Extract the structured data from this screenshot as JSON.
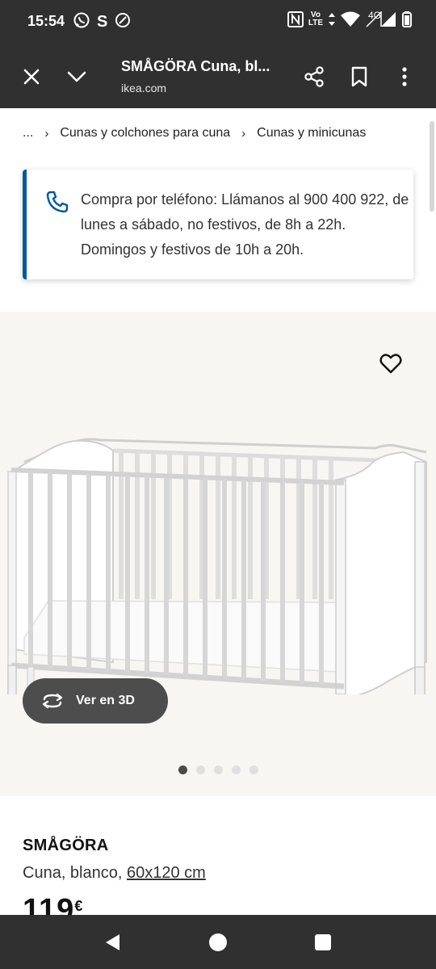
{
  "status": {
    "time": "15:54",
    "left_icons": [
      "whatsapp-icon",
      "s-app-icon",
      "leaf-app-icon"
    ],
    "right_icons": [
      "nfc-icon",
      "volte-icon",
      "data-arrows-icon",
      "wifi-icon",
      "signal-icon",
      "battery-icon"
    ],
    "volte_label_top": "Vo",
    "volte_label_bottom": "LTE",
    "network_label": "4G"
  },
  "toolbar": {
    "title": "SMÅGÖRA Cuna, bl...",
    "url": "ikea.com",
    "icons": [
      "close-icon",
      "chevron-down-icon",
      "share-icon",
      "bookmark-icon",
      "more-vert-icon"
    ]
  },
  "breadcrumb": {
    "ellipsis": "...",
    "items": [
      "Cunas y colchones para cuna",
      "Cunas y minicunas"
    ]
  },
  "info": {
    "icon": "phone-icon",
    "text": "Compra por teléfono: Llámanos al 900 400 922, de lunes a sábado, no festivos, de 8h a 22h. Domingos y festivos de 10h a 20h.",
    "accent_color": "#0058a3"
  },
  "gallery": {
    "favorite_icon": "heart-icon",
    "view_3d_label": "Ver en 3D",
    "view_3d_icon": "rotate-3d-icon",
    "slide_count": 5,
    "active_slide": 1
  },
  "product": {
    "name": "SMÅGÖRA",
    "desc_prefix": "Cuna, blanco, ",
    "size": "60x120 cm",
    "price": "119",
    "currency": "€"
  },
  "nav": {
    "icons": [
      "back-icon",
      "home-icon",
      "recents-icon"
    ]
  }
}
